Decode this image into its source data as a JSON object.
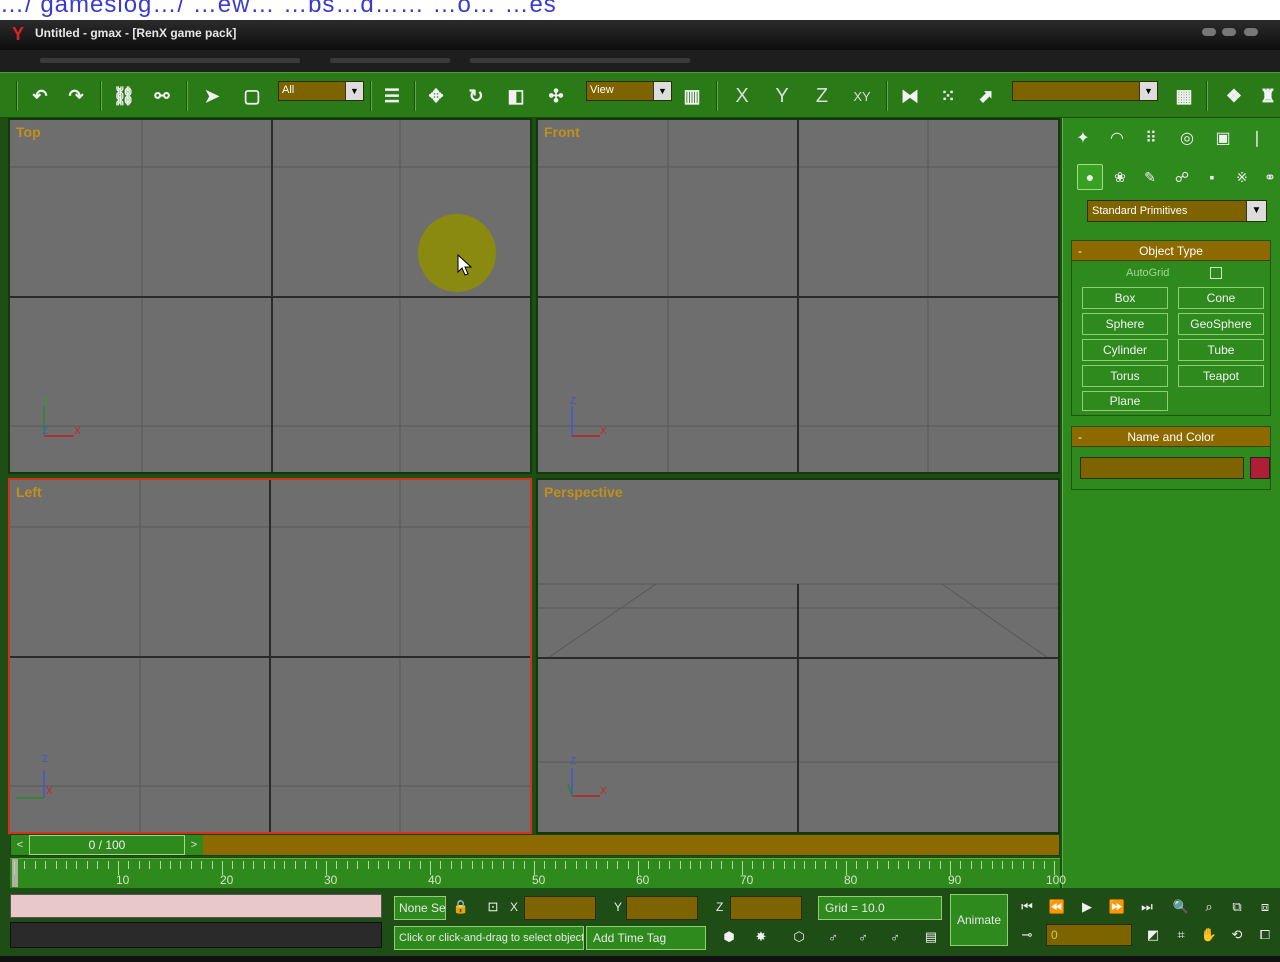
{
  "top_strip": {
    "text": "…/ gameslog…/ …ew… …bs…d…… …o… …es"
  },
  "window": {
    "title": "Untitled - gmax - [RenX game pack]"
  },
  "toolbar": {
    "selection_filter": "All",
    "reference_coord": "View",
    "axis_x": "X",
    "axis_y": "Y",
    "axis_z": "Z",
    "axis_xy": "XY",
    "named_selection": ""
  },
  "viewports": {
    "top": {
      "label": "Top",
      "axis_a": "Y",
      "axis_b": "Z",
      "axis_c": "X"
    },
    "front": {
      "label": "Front",
      "axis_a": "Z",
      "axis_c": "X"
    },
    "left": {
      "label": "Left",
      "axis_a": "Z",
      "axis_c": "X"
    },
    "perspective": {
      "label": "Perspective",
      "axis_a": "Z",
      "axis_c": "X"
    }
  },
  "command_panel": {
    "category": "Standard Primitives",
    "object_type": {
      "title": "Object Type",
      "pm": "-",
      "autogrid": "AutoGrid",
      "buttons": [
        "Box",
        "Cone",
        "Sphere",
        "GeoSphere",
        "Cylinder",
        "Tube",
        "Torus",
        "Teapot",
        "Plane"
      ]
    },
    "name_color": {
      "title": "Name and Color",
      "pm": "-",
      "name_value": "",
      "color": "#b01e36"
    }
  },
  "timeline": {
    "frame_label": "0 / 100",
    "prev": "<",
    "next": ">",
    "ticks": [
      "10",
      "20",
      "30",
      "40",
      "50",
      "60",
      "70",
      "80",
      "90",
      "100"
    ]
  },
  "status": {
    "selection": "None Se",
    "x_label": "X",
    "y_label": "Y",
    "z_label": "Z",
    "grid": "Grid = 10.0",
    "prompt": "Click or click-and-drag to select objects",
    "add_time_tag": "Add Time Tag",
    "animate": "Animate",
    "current_frame": "0"
  }
}
